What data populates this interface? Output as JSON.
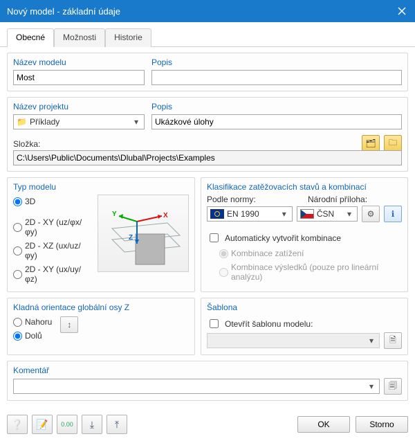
{
  "window": {
    "title": "Nový model - základní údaje"
  },
  "tabs": {
    "general": "Obecné",
    "options": "Možnosti",
    "history": "Historie"
  },
  "model_name": {
    "title": "Název modelu",
    "value": "Most"
  },
  "model_desc": {
    "title": "Popis",
    "value": ""
  },
  "project_name": {
    "title": "Název projektu",
    "value": "Příklady"
  },
  "project_desc": {
    "title": "Popis",
    "value": "Ukázkové úlohy"
  },
  "folder": {
    "title": "Složka:",
    "path": "C:\\Users\\Public\\Documents\\Dlubal\\Projects\\Examples"
  },
  "model_type": {
    "title": "Typ modelu",
    "opts": {
      "r3d": "3D",
      "r2dxy": "2D - XY (uz/φx/φy)",
      "r2dxz": "2D - XZ (ux/uz/φy)",
      "r2dxy2": "2D - XY (ux/uy/φz)"
    },
    "selected": "r3d"
  },
  "z_orient": {
    "title": "Kladná orientace globální osy Z",
    "up": "Nahoru",
    "down": "Dolů",
    "selected": "down"
  },
  "classification": {
    "title": "Klasifikace zatěžovacích stavů a kombinací",
    "standard_label": "Podle normy:",
    "annex_label": "Národní příloha:",
    "standard": "EN 1990",
    "annex": "ČSN",
    "auto_combi": "Automaticky vytvořit kombinace",
    "combi_load": "Kombinace zatížení",
    "combi_result": "Kombinace výsledků (pouze pro lineární analýzu)"
  },
  "template": {
    "title": "Šablona",
    "open_label": "Otevřít šablonu modelu:",
    "value": ""
  },
  "comment": {
    "title": "Komentář",
    "value": ""
  },
  "buttons": {
    "ok": "OK",
    "cancel": "Storno"
  }
}
